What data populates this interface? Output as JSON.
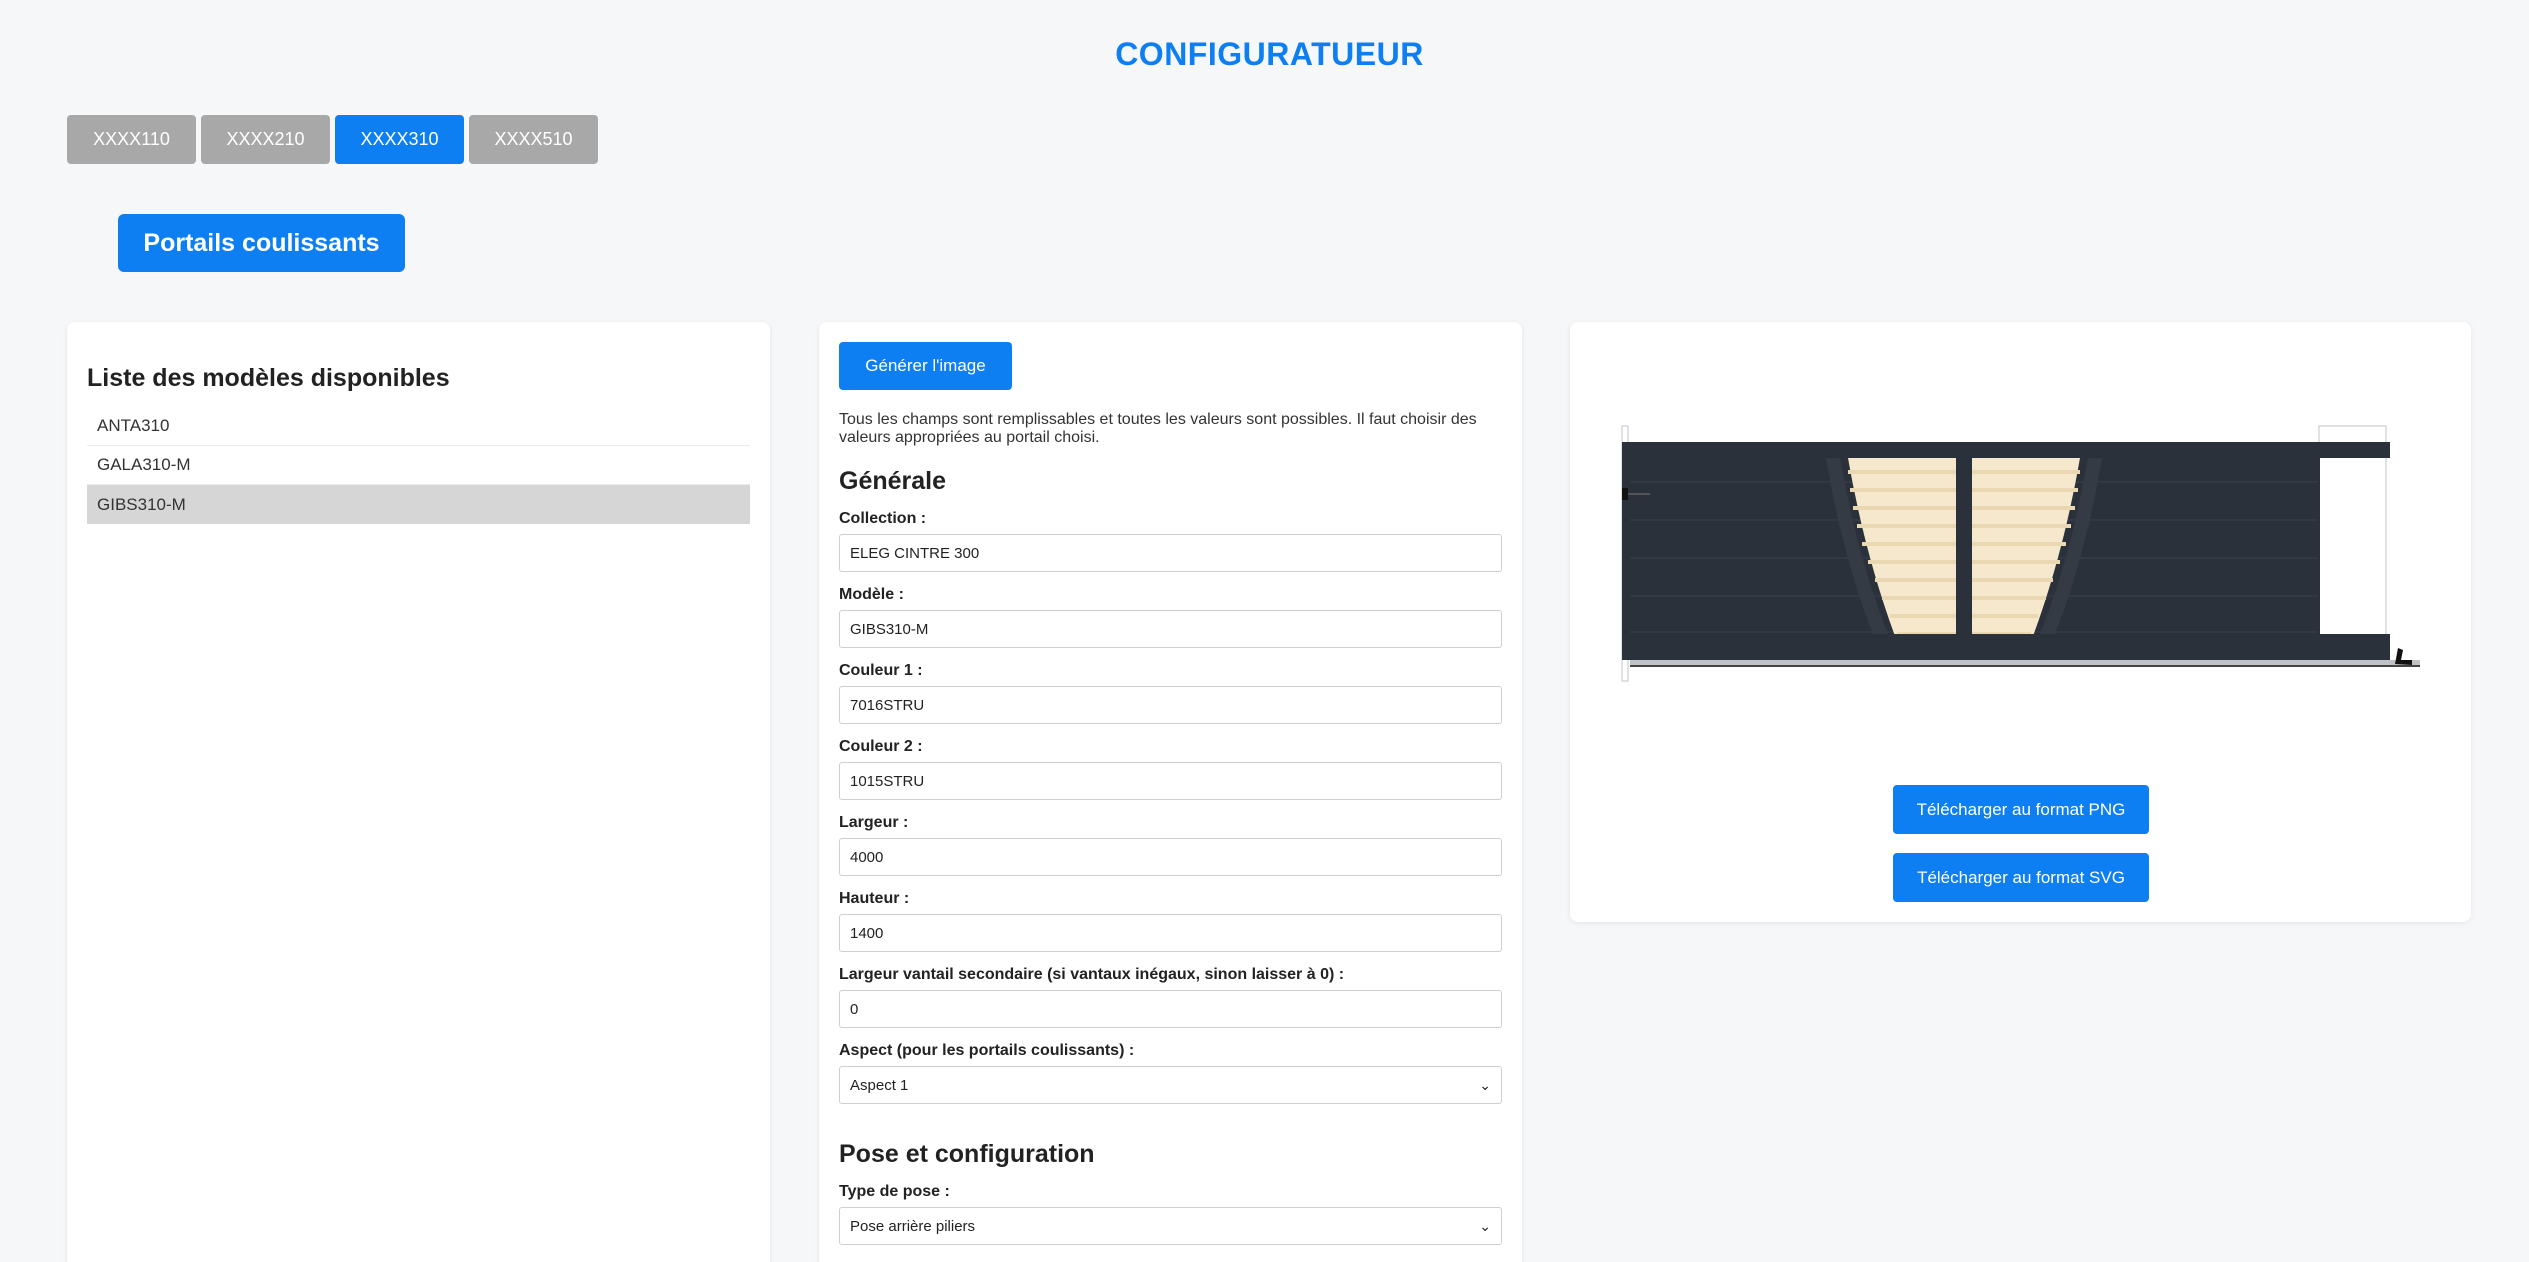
{
  "app_title": "CONFIGURATUEUR",
  "tabs": [
    {
      "label": "XXXX110",
      "active": false
    },
    {
      "label": "XXXX210",
      "active": false
    },
    {
      "label": "XXXX310",
      "active": true
    },
    {
      "label": "XXXX510",
      "active": false
    }
  ],
  "category_button": "Portails coulissants",
  "models": {
    "title": "Liste des modèles disponibles",
    "items": [
      {
        "label": "ANTA310",
        "selected": false
      },
      {
        "label": "GALA310-M",
        "selected": false
      },
      {
        "label": "GIBS310-M",
        "selected": true
      }
    ]
  },
  "form": {
    "generate_button": "Générer l'image",
    "info": "Tous les champs sont remplissables et toutes les valeurs sont possibles. Il faut choisir des valeurs appropriées au portail choisi.",
    "section_general": "Générale",
    "collection": {
      "label": "Collection :",
      "value": "ELEG CINTRE 300"
    },
    "modele": {
      "label": "Modèle :",
      "value": "GIBS310-M"
    },
    "couleur1": {
      "label": "Couleur 1 :",
      "value": "7016STRU"
    },
    "couleur2": {
      "label": "Couleur 2 :",
      "value": "1015STRU"
    },
    "largeur": {
      "label": "Largeur :",
      "value": "4000"
    },
    "hauteur": {
      "label": "Hauteur :",
      "value": "1400"
    },
    "largeur_secondaire": {
      "label": "Largeur vantail secondaire (si vantaux inégaux, sinon laisser à 0) :",
      "value": "0"
    },
    "aspect": {
      "label": "Aspect (pour les portails coulissants) :",
      "value": "Aspect 1"
    },
    "section_pose": "Pose et configuration",
    "type_pose": {
      "label": "Type de pose :",
      "value": "Pose arrière piliers"
    }
  },
  "preview": {
    "download_png": "Télécharger au format PNG",
    "download_svg": "Télécharger au format SVG",
    "colors": {
      "frame": "#2b313a",
      "infill": "#f6e8cc"
    }
  }
}
